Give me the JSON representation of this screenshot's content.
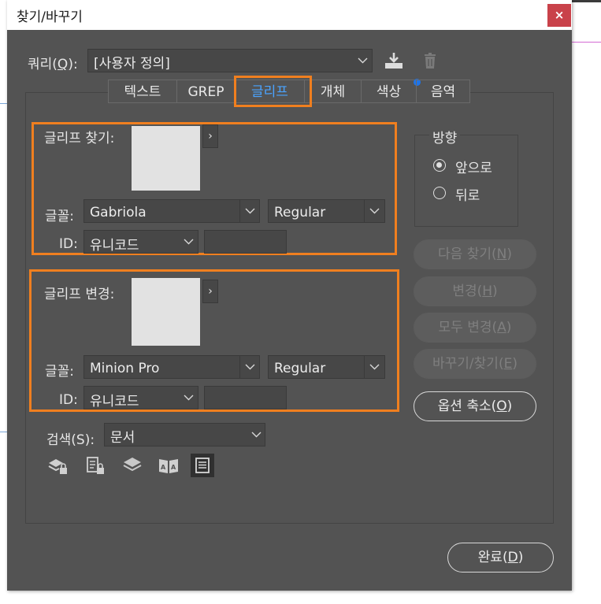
{
  "window": {
    "title": "찾기/바꾸기",
    "close_label": "×"
  },
  "query": {
    "label": "쿼리(",
    "mnemonic": "Q",
    "label_end": "):",
    "value": "[사용자 정의]"
  },
  "tabs": [
    {
      "label": "텍스트",
      "active": false
    },
    {
      "label": "GREP",
      "active": false
    },
    {
      "label": "글리프",
      "active": true
    },
    {
      "label": "개체",
      "active": false
    },
    {
      "label": "색상",
      "active": false,
      "dot": true
    },
    {
      "label": "음역",
      "active": false
    }
  ],
  "find_glyph": {
    "label": "글리프 찾기:",
    "font_label": "글꼴:",
    "font_value": "Gabriola",
    "style_value": "Regular",
    "id_label": "ID:",
    "id_type": "유니코드",
    "id_value": ""
  },
  "change_glyph": {
    "label": "글리프 변경:",
    "font_label": "글꼴:",
    "font_value": "Minion Pro",
    "style_value": "Regular",
    "id_label": "ID:",
    "id_type": "유니코드",
    "id_value": ""
  },
  "direction": {
    "title": "방향",
    "options": [
      {
        "label": "앞으로",
        "selected": true
      },
      {
        "label": "뒤로",
        "selected": false
      }
    ]
  },
  "buttons": {
    "find_next": {
      "label": "다음 찾기(",
      "mnemonic": "N",
      "end": ")"
    },
    "change": {
      "label": "변경(",
      "mnemonic": "H",
      "end": ")"
    },
    "change_all": {
      "label": "모두 변경(",
      "mnemonic": "A",
      "end": ")"
    },
    "change_find": {
      "label": "바꾸기/찾기(",
      "mnemonic": "E",
      "end": ")"
    },
    "fewer_options": {
      "label": "옵션 축소(",
      "mnemonic": "O",
      "end": ")"
    },
    "done": {
      "label": "완료(",
      "mnemonic": "D",
      "end": ")"
    }
  },
  "search": {
    "label": "검색(S):",
    "value": "문서"
  },
  "search_icons": [
    "include-locked-layers-icon",
    "include-locked-stories-icon",
    "include-hidden-layers-icon",
    "include-master-pages-icon",
    "include-footnotes-icon"
  ],
  "colors": {
    "dialog_bg": "#535353",
    "accent_blue": "#4aa3ff",
    "highlight_orange": "#f07f1f",
    "close_red": "#c9424a",
    "color_tab_dot": "#1f74e8"
  }
}
